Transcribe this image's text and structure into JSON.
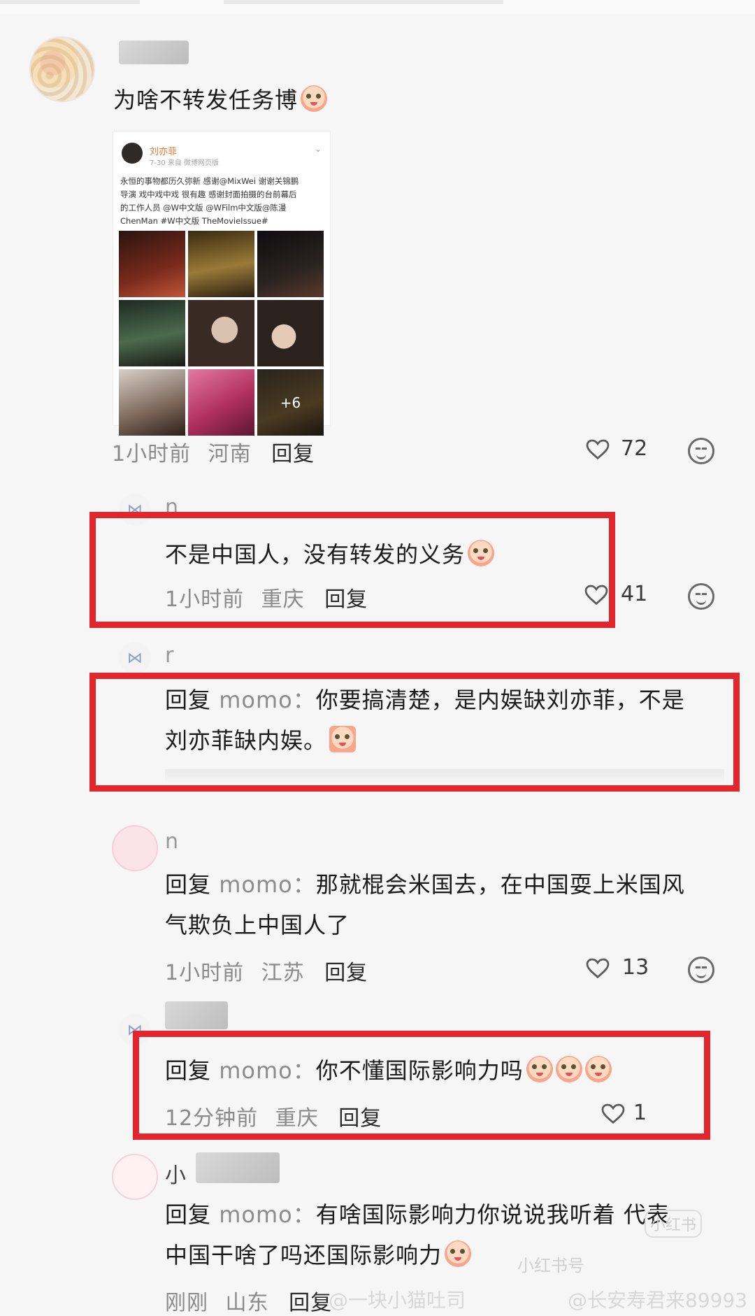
{
  "post": {
    "text": "为啥不转发任务博",
    "time": "1小时前",
    "location": "河南",
    "reply_label": "回复",
    "likes": "72"
  },
  "embedded": {
    "author": "刘亦菲",
    "meta": "7-30  来自 微博网页版",
    "body_lines": [
      "永恒的事物都历久弥新  感谢@MixWei 谢谢关锦鹏",
      "导演  戏中戏中戏 很有趣  感谢封面拍摄的台前幕后",
      "的工作人员 @W中文版 @WFilm中文版@陈漫",
      "ChenMan #W中文版 TheMovieIssue#"
    ],
    "more_count": "+6"
  },
  "comments": [
    {
      "username": "n",
      "text": "不是中国人，没有转发的义务",
      "time": "1小时前",
      "location": "重庆",
      "reply_label": "回复",
      "likes": "41"
    },
    {
      "username": "r",
      "reply_prefix": "回复",
      "mention": "momo：",
      "text_line1": "你要搞清楚，是内娱缺刘亦菲，不是",
      "text_line2": "刘亦菲缺内娱。"
    },
    {
      "username": "n",
      "reply_prefix": "回复",
      "mention": "momo：",
      "text_line1": "那就棍会米国去，在中国耍上米国风",
      "text_line2": "气欺负上中国人了",
      "time": "1小时前",
      "location": "江苏",
      "reply_label": "回复",
      "likes": "13"
    },
    {
      "reply_prefix": "回复",
      "mention": "momo：",
      "text": "你不懂国际影响力吗",
      "time": "12分钟前",
      "location": "重庆",
      "reply_label": "回复",
      "likes": "1"
    },
    {
      "username": "小",
      "reply_prefix": "回复",
      "mention": "momo：",
      "text_line1": "有啥国际影响力你说说我听着  代表",
      "text_line2": "中国干啥了吗还国际影响力",
      "time": "刚刚",
      "location": "山东",
      "reply_label": "回复"
    }
  ],
  "watermarks": {
    "left": "@一块小猫吐司",
    "right": "@长安寿君来89993",
    "mid": "小红书号",
    "stamp": "小红书"
  },
  "colors": {
    "highlight_box": "#e3262c",
    "embedded_name": "#e57a3a",
    "mention_link": "#4a6fb5"
  }
}
